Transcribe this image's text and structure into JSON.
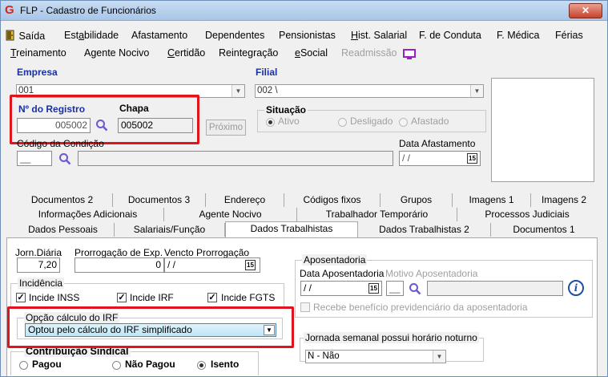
{
  "window": {
    "title": "FLP - Cadastro de Funcionários",
    "close": "✕"
  },
  "menu1": [
    {
      "pre": "",
      "u": "",
      "post": "Saída"
    },
    {
      "pre": "Est",
      "u": "a",
      "post": "bilidade"
    },
    {
      "pre": "",
      "u": "",
      "post": "Afastamento"
    },
    {
      "pre": "",
      "u": "",
      "post": "Dependentes"
    },
    {
      "pre": "",
      "u": "",
      "post": "Pensionistas"
    },
    {
      "pre": "",
      "u": "H",
      "post": "ist. Salarial"
    },
    {
      "pre": "",
      "u": "",
      "post": "F. de Conduta"
    },
    {
      "pre": "",
      "u": "",
      "post": "F. Médica"
    },
    {
      "pre": "",
      "u": "",
      "post": "Férias"
    }
  ],
  "menu2": [
    {
      "pre": "",
      "u": "T",
      "post": "reinamento"
    },
    {
      "pre": "",
      "u": "",
      "post": "Agente Nocivo"
    },
    {
      "pre": "",
      "u": "C",
      "post": "ertidão"
    },
    {
      "pre": "",
      "u": "",
      "post": "Reintegração"
    },
    {
      "pre": "",
      "u": "e",
      "post": "Social"
    },
    {
      "pre": "",
      "u": "",
      "post": "Readmissão"
    }
  ],
  "header": {
    "empresa_label": "Empresa",
    "empresa_value": "001",
    "filial_label": "Filial",
    "filial_value": "002 \\",
    "registro_label": "Nº do Registro",
    "registro_value": "005002",
    "chapa_label": "Chapa",
    "chapa_value": "005002",
    "proximo_label": "Próximo",
    "situacao_label": "Situação",
    "situacao_options": [
      "Ativo",
      "Desligado",
      "Afastado"
    ],
    "codigo_label": "Código da Condição",
    "codigo_value": "__",
    "data_afast_label": "Data Afastamento",
    "data_afast_value": "/ /"
  },
  "tabs": {
    "row1": [
      "Documentos 2",
      "Documentos 3",
      "Endereço",
      "Códigos fixos",
      "Grupos",
      "Imagens 1",
      "Imagens 2"
    ],
    "row2": [
      "Informações Adicionais",
      "Agente Nocivo",
      "Trabalhador Temporário",
      "Processos Judiciais"
    ],
    "row3": [
      "Dados Pessoais",
      "Salariais/Função",
      "Dados Trabalhistas",
      "Dados Trabalhistas 2",
      "Documentos 1"
    ]
  },
  "panel": {
    "jorn_label": "Jorn.Diária",
    "jorn_value": "7,20",
    "prorrog_label": "Prorrogação de Exp.",
    "prorrog_value": "0",
    "vencto_label": "Vencto Prorrogação",
    "vencto_value": "/ /",
    "incidencia_label": "Incidência",
    "inss_label": "Incide INSS",
    "irf_label": "Incide IRF",
    "fgts_label": "Incide FGTS",
    "opcao_label": "Opção cálculo do IRF",
    "opcao_value": "Optou pelo cálculo do IRF simplificado",
    "contrib_label": "Contribuição Sindical",
    "contrib_options": [
      "Pagou",
      "Não Pagou",
      "Isento"
    ],
    "apos_label": "Aposentadoria",
    "data_apos_label": "Data Aposentadoria",
    "motivo_label": "Motivo Aposentadoria",
    "data_apos_value": "/ /",
    "motivo_code": "__",
    "recebe_label": "Recebe benefício previdenciário da aposentadoria",
    "jornada_label": "Jornada semanal possui horário noturno",
    "jornada_value": "N - Não",
    "cal_icon_text": "15",
    "info_text": "i"
  },
  "colors": {
    "highlight": "#e0141c",
    "label_blue": "#1a2fa0",
    "magnifier": "#6a5acd"
  }
}
